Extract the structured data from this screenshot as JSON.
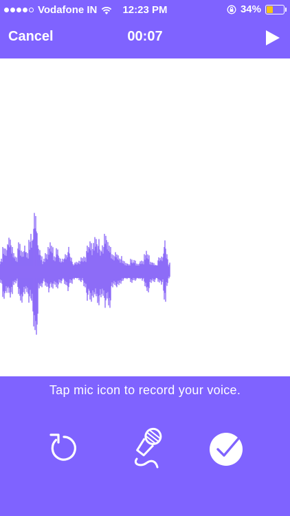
{
  "status_bar": {
    "signal_bars_filled": 4,
    "signal_bars_total": 5,
    "carrier": "Vodafone IN",
    "time": "12:23 PM",
    "battery_percent_text": "34%",
    "battery_level": 0.34,
    "icons": [
      "wifi-icon",
      "orientation-lock-icon",
      "battery-icon"
    ]
  },
  "navbar": {
    "cancel_label": "Cancel",
    "timer": "00:07",
    "play_icon": "play-icon"
  },
  "recorder": {
    "hint": "Tap mic icon to record your voice.",
    "controls": [
      "reset-icon",
      "mic-icon",
      "checkmark-icon"
    ]
  },
  "colors": {
    "accent": "#7f63ff",
    "waveform": "#8d6cf7",
    "battery": "#f5c518",
    "background": "#ffffff"
  }
}
